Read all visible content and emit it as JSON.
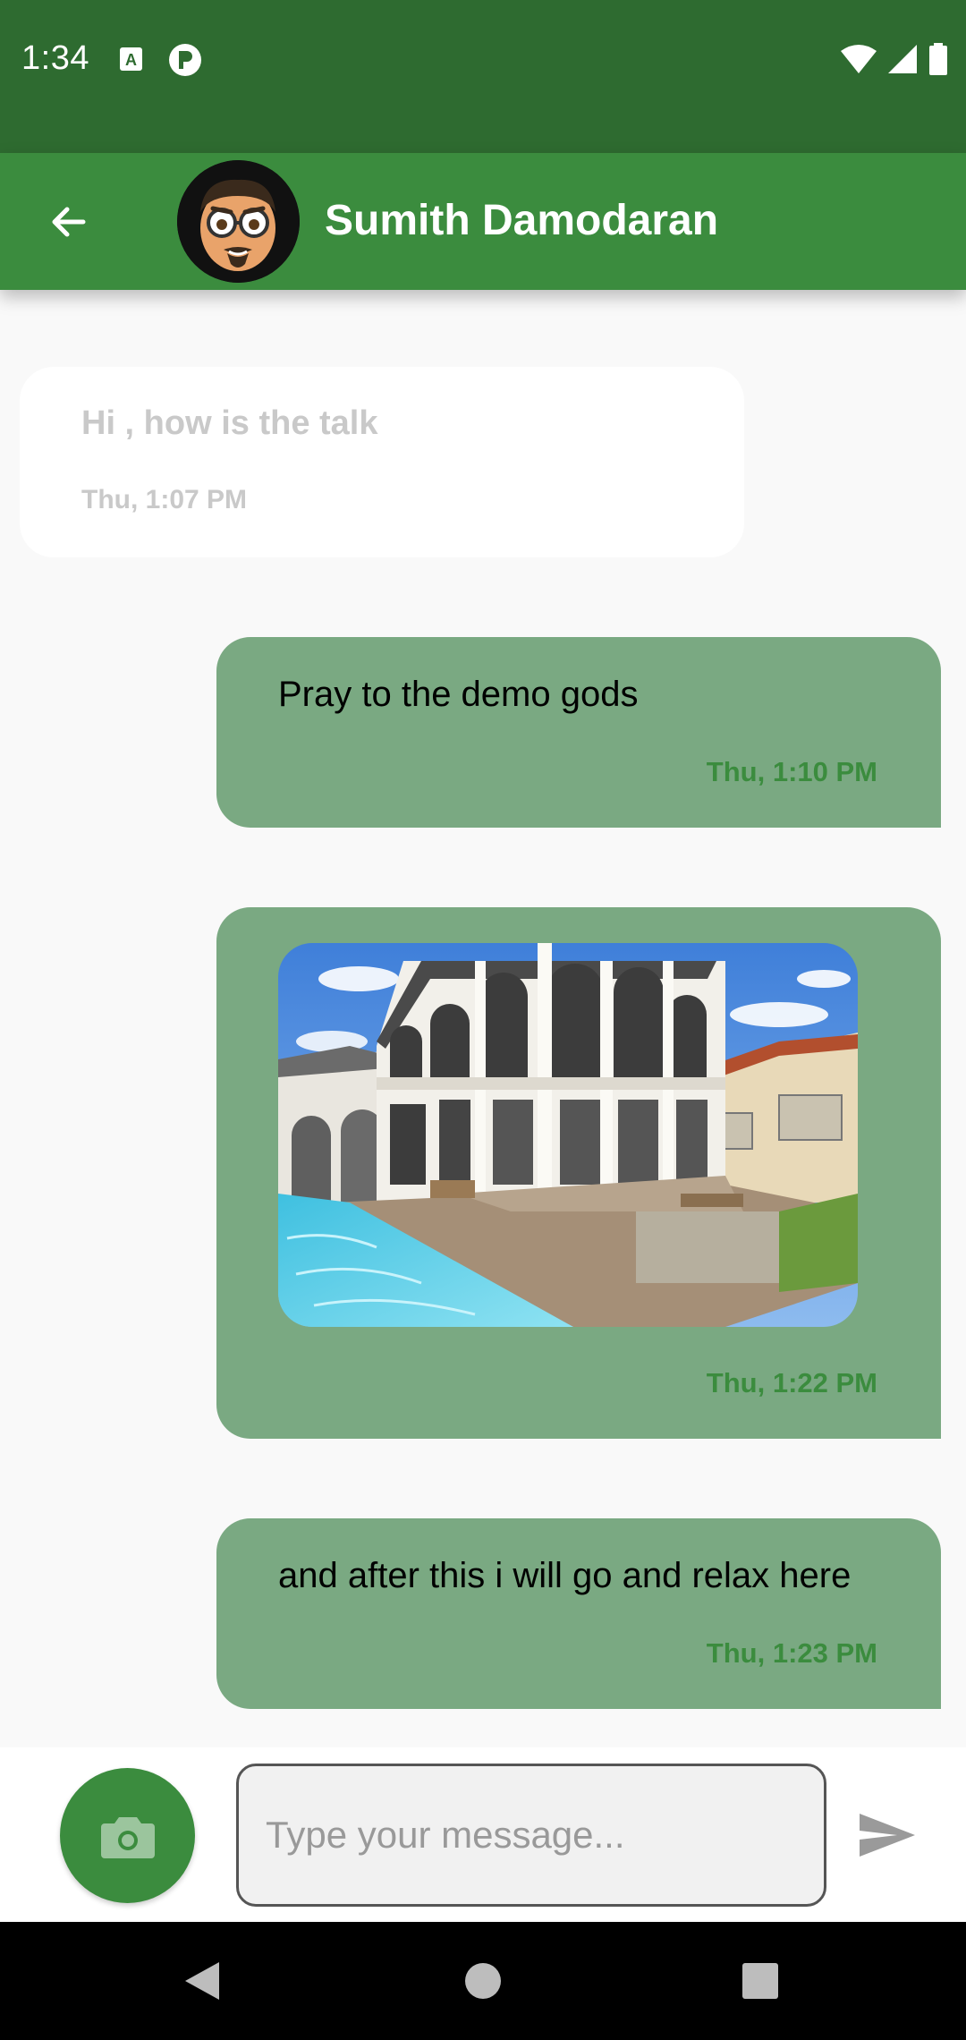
{
  "status_bar": {
    "time": "1:34",
    "icons": [
      "a-notification-icon",
      "p-notification-icon",
      "wifi-icon",
      "signal-icon",
      "battery-icon"
    ]
  },
  "app_bar": {
    "back_icon": "arrow-left-icon",
    "contact_name": "Sumith Damodaran"
  },
  "messages": [
    {
      "direction": "incoming",
      "text": "Hi , how is the talk",
      "time": "Thu, 1:07 PM"
    },
    {
      "direction": "outgoing",
      "text": "Pray to the demo gods",
      "time": "Thu, 1:10 PM"
    },
    {
      "direction": "outgoing",
      "type": "image",
      "image": "house-with-pool-photo",
      "time": "Thu, 1:22 PM"
    },
    {
      "direction": "outgoing",
      "text": "and after this i will go and relax here",
      "time": "Thu, 1:23 PM"
    }
  ],
  "composer": {
    "placeholder": "Type your message...",
    "value": "",
    "camera_icon": "camera-icon",
    "send_icon": "send-icon"
  },
  "nav_bar": {
    "icons": [
      "back-triangle-icon",
      "home-circle-icon",
      "recents-square-icon"
    ]
  },
  "colors": {
    "status_bar": "#2e6b30",
    "app_bar": "#3b8c3e",
    "outgoing_bubble": "#7aa982",
    "incoming_bubble": "#ffffff",
    "timestamp_outgoing": "#3b8c3e"
  }
}
